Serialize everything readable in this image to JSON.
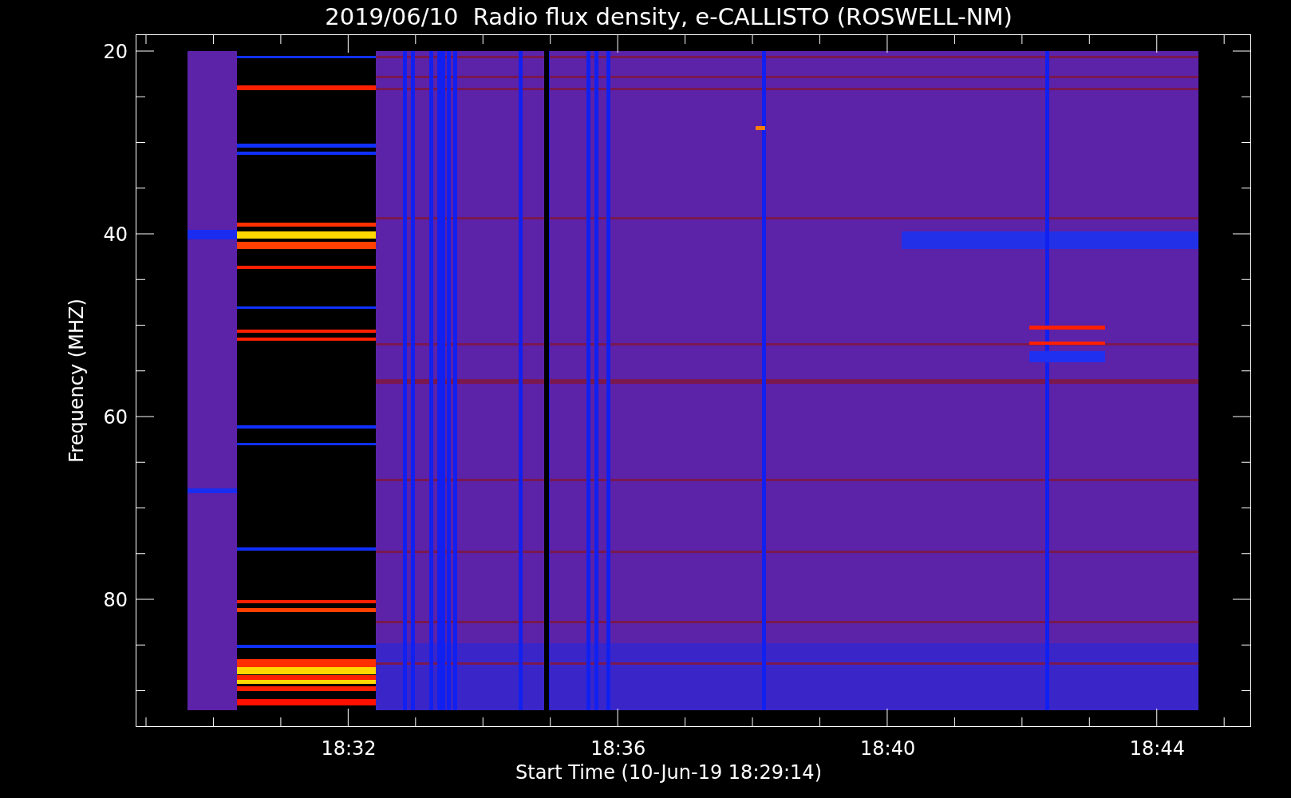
{
  "title": "2019/06/10  Radio flux density, e-CALLISTO (ROSWELL-NM)",
  "y_axis": {
    "label": "Frequency (MHZ)",
    "ticks": [
      "20",
      "40",
      "60",
      "80"
    ]
  },
  "x_axis": {
    "label": "Start Time (10-Jun-19 18:29:14)",
    "ticks": [
      "18:32",
      "18:36",
      "18:40",
      "18:44"
    ]
  }
}
